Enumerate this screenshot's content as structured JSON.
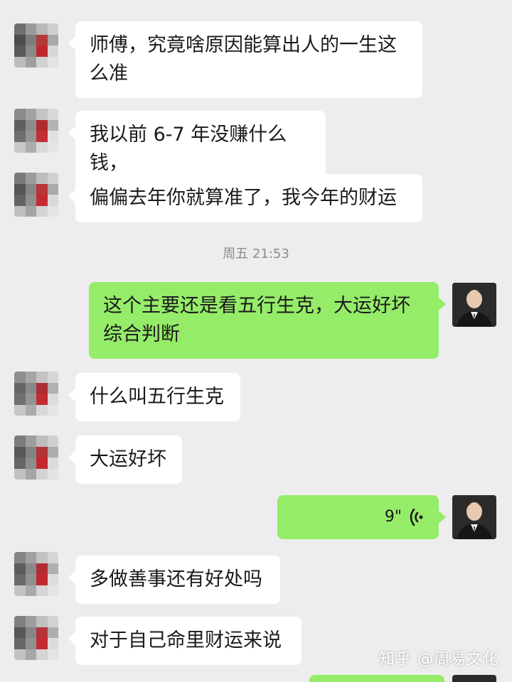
{
  "conversation": {
    "messages": [
      {
        "text": "师傅，究竟啥原因能算出人的一生这么准"
      },
      {
        "text": "我以前 6-7 年没赚什么钱，"
      },
      {
        "text": "偏偏去年你就算准了，我今年的财运"
      },
      {
        "text": "这个主要还是看五行生克，大运好坏综合判断"
      },
      {
        "text": "什么叫五行生克"
      },
      {
        "text": "大运好坏"
      },
      {
        "duration": "9\""
      },
      {
        "text": "多做善事还有好处吗"
      },
      {
        "text": "对于自己命里财运来说"
      }
    ],
    "timestamp": "周五 21:53"
  },
  "watermark": "知乎 @周易文化",
  "colors": {
    "background": "#ededed",
    "incoming_bubble": "#ffffff",
    "outgoing_bubble": "#95ec69"
  },
  "icons": {
    "incoming_avatar": "mosaic-avatar-icon",
    "outgoing_avatar": "person-avatar-icon",
    "voice": "voice-wave-icon"
  }
}
